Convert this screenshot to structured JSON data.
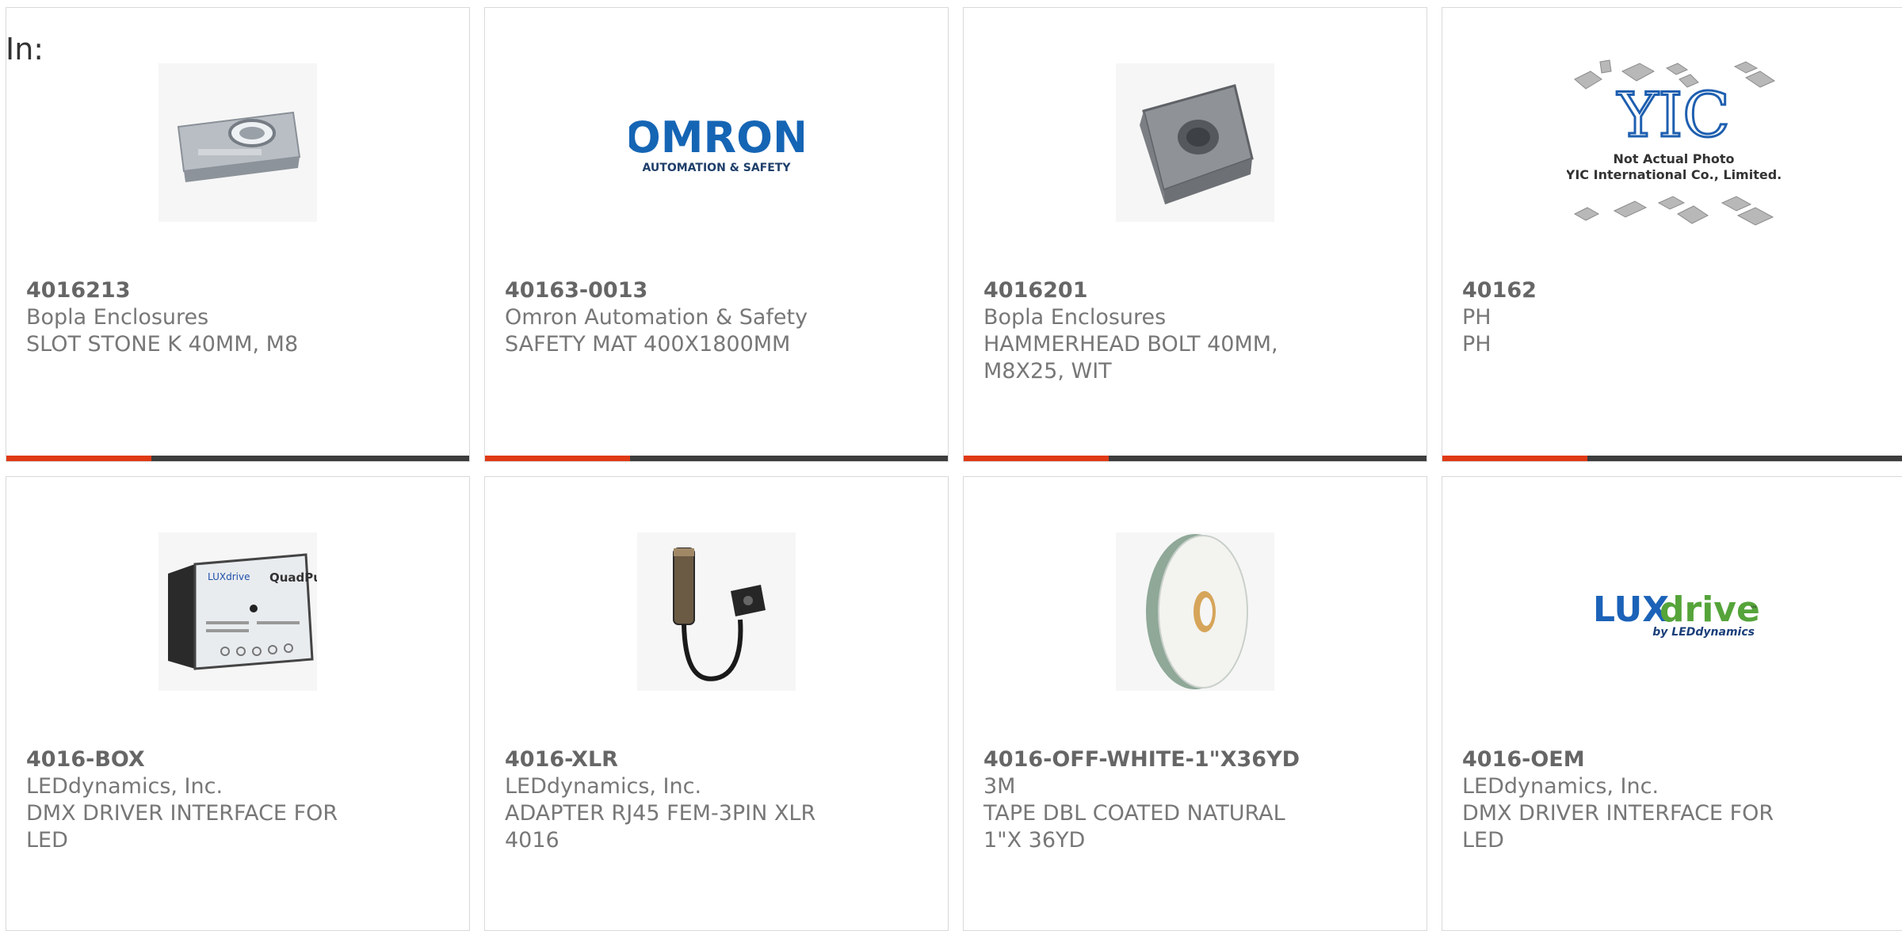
{
  "header": {
    "label": "In:"
  },
  "colors": {
    "accent": "#e03a14",
    "bar": "#3d3d3d",
    "text": "#666666"
  },
  "products": [
    {
      "part_number": "4016213",
      "manufacturer": "Bopla Enclosures",
      "description": "SLOT STONE K 40MM, M8",
      "image": "slot-stone-image"
    },
    {
      "part_number": "40163-0013",
      "manufacturer": "Omron Automation & Safety",
      "description": "SAFETY MAT 400X1800MM",
      "image": "omron-logo",
      "logo_text": "OMRON",
      "logo_subtext": "AUTOMATION & SAFETY"
    },
    {
      "part_number": "4016201",
      "manufacturer": "Bopla Enclosures",
      "description": "HAMMERHEAD BOLT 40MM, M8X25, WIT",
      "image": "hammerhead-bolt-image"
    },
    {
      "part_number": "40162",
      "manufacturer": "PH",
      "description": "PH",
      "image": "yic-placeholder-image",
      "logo_text": "YIC",
      "placeholder_line1": "Not Actual Photo",
      "placeholder_line2": "YIC International Co., Limited."
    },
    {
      "part_number": "4016-BOX",
      "manufacturer": "LEDdynamics, Inc.",
      "description": "DMX DRIVER INTERFACE FOR LED",
      "image": "driver-box-image",
      "box_brand": "LUXdrive",
      "box_model": "QuadPuck"
    },
    {
      "part_number": "4016-XLR",
      "manufacturer": "LEDdynamics, Inc.",
      "description": "ADAPTER RJ45 FEM-3PIN XLR 4016",
      "image": "xlr-adapter-image"
    },
    {
      "part_number": "4016-OFF-WHITE-1\"X36YD",
      "manufacturer": "3M",
      "description": "TAPE DBL COATED NATURAL 1\"X 36YD",
      "image": "tape-roll-image"
    },
    {
      "part_number": "4016-OEM",
      "manufacturer": "LEDdynamics, Inc.",
      "description": "DMX DRIVER INTERFACE FOR LED",
      "image": "luxdrive-logo",
      "logo_text_a": "LUX",
      "logo_text_b": "drive",
      "logo_tm": "™",
      "logo_subtext": "by LEDdynamics"
    }
  ]
}
